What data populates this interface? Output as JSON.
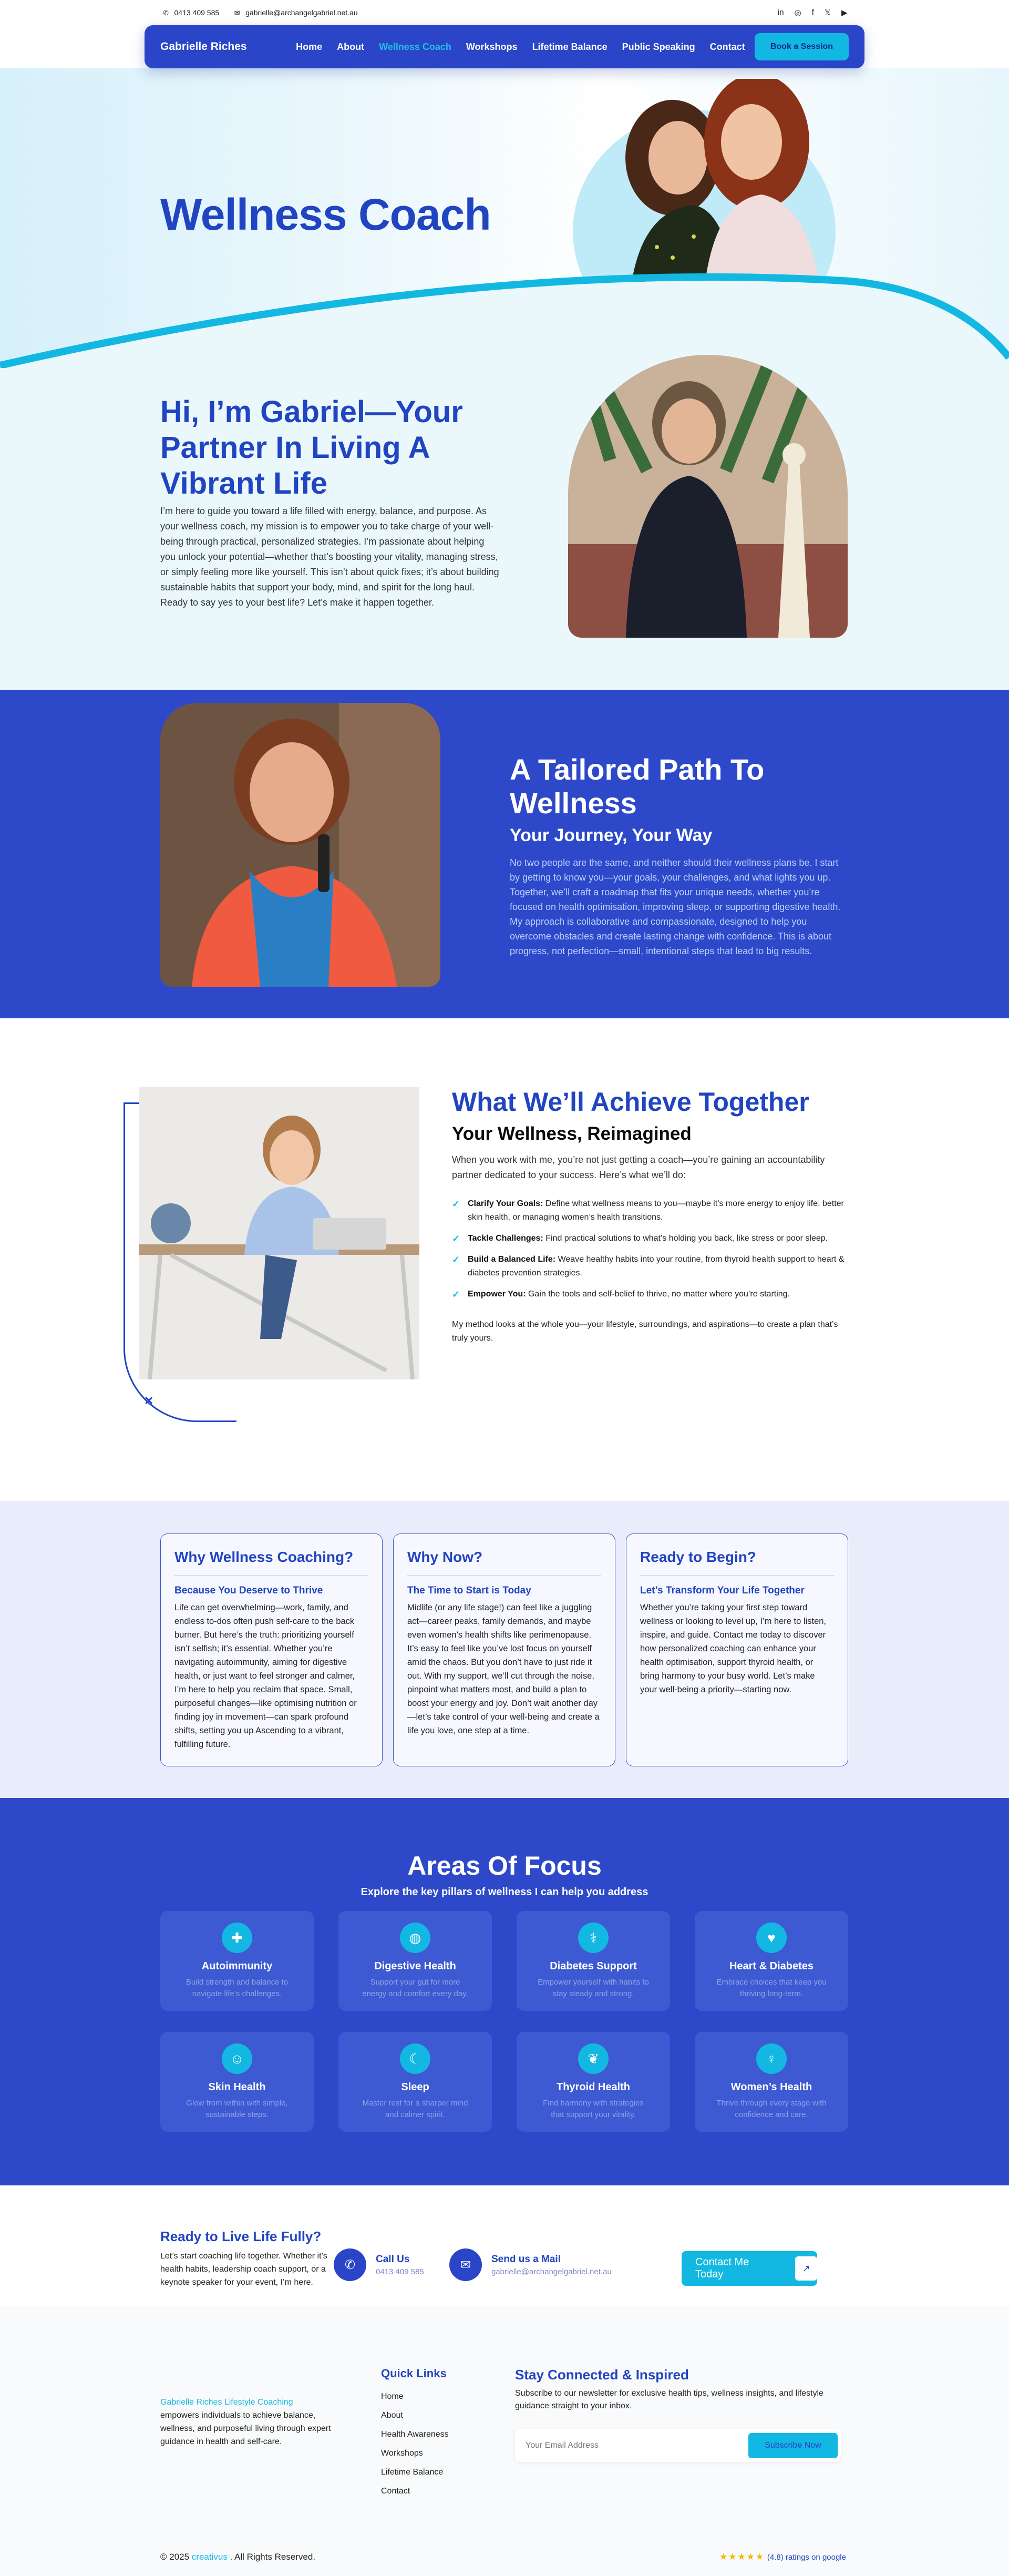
{
  "topbar": {
    "phone": "0413 409 585",
    "email": "gabrielle@archangelgabriel.net.au",
    "social": [
      {
        "icon": "linkedin-icon",
        "glyph": "in"
      },
      {
        "icon": "instagram-icon",
        "glyph": "◎"
      },
      {
        "icon": "facebook-icon",
        "glyph": "f"
      },
      {
        "icon": "x-icon",
        "glyph": "𝕏"
      },
      {
        "icon": "youtube-icon",
        "glyph": "▶"
      }
    ]
  },
  "nav": {
    "brand": "Gabrielle Riches",
    "items": [
      "Home",
      "About",
      "Wellness Coach",
      "Workshops",
      "Lifetime Balance",
      "Public Speaking",
      "Contact"
    ],
    "active_index": 2,
    "cta": "Book a Session"
  },
  "hero": {
    "title": "Wellness Coach"
  },
  "intro": {
    "heading": "Hi, I’m Gabriel—Your Partner In Living A Vibrant Life",
    "body": "I’m here to guide you toward a life filled with energy, balance, and purpose. As your wellness coach, my mission is to empower you to take charge of your well-being through practical, personalized strategies. I’m passionate about helping you unlock your potential—whether that’s boosting your vitality, managing stress, or simply feeling more like yourself. This isn’t about quick fixes; it’s about building sustainable habits that support your body, mind, and spirit for the long haul. Ready to say yes to your best life? Let’s make it happen together."
  },
  "tailored": {
    "heading": "A Tailored Path To Wellness",
    "subheading": "Your Journey, Your Way",
    "body": "No two people are the same, and neither should their wellness plans be. I start by getting to know you—your goals, your challenges, and what lights you up. Together, we’ll craft a roadmap that fits your unique needs, whether you’re focused on health optimisation, improving sleep, or supporting digestive health. My approach is collaborative and compassionate, designed to help you overcome obstacles and create lasting change with confidence. This is about progress, not perfection—small, intentional steps that lead to big results."
  },
  "achieve": {
    "heading": "What We’ll Achieve Together",
    "subheading": "Your Wellness, Reimagined",
    "lead": "When you work with me, you’re not just getting a coach—you’re gaining an accountability partner dedicated to your success. Here’s what we’ll do:",
    "items": [
      {
        "title": "Clarify Your Goals:",
        "text": " Define what wellness means to you—maybe it’s more energy to enjoy life, better skin health, or managing women’s health transitions."
      },
      {
        "title": "Tackle Challenges:",
        "text": " Find practical solutions to what’s holding you back, like stress or poor sleep."
      },
      {
        "title": "Build a Balanced Life:",
        "text": " Weave healthy habits into your routine, from thyroid health support to heart & diabetes prevention strategies."
      },
      {
        "title": "Empower You:",
        "text": " Gain the tools and self-belief to thrive, no matter where you’re starting."
      }
    ],
    "closing": "My method looks at the whole you—your lifestyle, surroundings, and aspirations—to create a plan that’s truly yours."
  },
  "why": [
    {
      "title": "Why Wellness Coaching?",
      "subtitle": "Because You Deserve to Thrive",
      "body": "Life can get overwhelming—work, family, and endless to-dos often push self-care to the back burner. But here’s the truth: prioritizing yourself isn’t selfish; it’s essential. Whether you’re navigating autoimmunity, aiming for digestive health, or just want to feel stronger and calmer, I’m here to help you reclaim that space. Small, purposeful changes—like optimising nutrition or finding joy in movement—can spark profound shifts, setting you up Ascending to a vibrant, fulfilling future."
    },
    {
      "title": "Why Now?",
      "subtitle": "The Time to Start is Today",
      "body": "Midlife (or any life stage!) can feel like a juggling act—career peaks, family demands, and maybe even women’s health shifts like perimenopause. It’s easy to feel like you’ve lost focus on yourself amid the chaos. But you don’t have to just ride it out. With my support, we’ll cut through the noise, pinpoint what matters most, and build a plan to boost your energy and joy. Don’t wait another day—let’s take control of your well-being and create a life you love, one step at a time."
    },
    {
      "title": "Ready to Begin?",
      "subtitle": "Let’s Transform Your Life Together",
      "body": "Whether you’re taking your first step toward wellness or looking to level up, I’m here to listen, inspire, and guide. Contact me today to discover how personalized coaching can enhance your health optimisation, support thyroid health, or bring harmony to your busy world. Let’s make your well-being a priority—starting now."
    }
  ],
  "areas": {
    "heading": "Areas Of Focus",
    "subheading": "Explore the key pillars of wellness I can help you address",
    "tiles": [
      {
        "icon": "shield-icon",
        "glyph": "✚",
        "title": "Autoimmunity",
        "text": "Build strength and balance to navigate life’s challenges."
      },
      {
        "icon": "stomach-icon",
        "glyph": "◍",
        "title": "Digestive Health",
        "text": "Support your gut for more energy and comfort every day."
      },
      {
        "icon": "glucose-icon",
        "glyph": "⚕",
        "title": "Diabetes Support",
        "text": "Empower yourself with habits to stay steady and strong."
      },
      {
        "icon": "heart-icon",
        "glyph": "♥",
        "title": "Heart & Diabetes",
        "text": "Embrace choices that keep you thriving long-term."
      },
      {
        "icon": "skin-icon",
        "glyph": "☺",
        "title": "Skin Health",
        "text": "Glow from within with simple, sustainable steps."
      },
      {
        "icon": "moon-icon",
        "glyph": "☾",
        "title": "Sleep",
        "text": "Master rest for a sharper mind and calmer spirit."
      },
      {
        "icon": "thyroid-icon",
        "glyph": "❦",
        "title": "Thyroid Health",
        "text": "Find harmony with strategies that support your vitality."
      },
      {
        "icon": "female-icon",
        "glyph": "♀",
        "title": "Women’s Health",
        "text": "Thrive through every stage with confidence and care."
      }
    ]
  },
  "strip": {
    "heading": "Ready to Live Life Fully?",
    "body": "Let’s start coaching life together. Whether it’s health habits, leadership coach support, or a keynote speaker for your event, I’m here.",
    "call_label": "Call Us",
    "call_value": "0413 409 585",
    "mail_label": "Send us a Mail",
    "mail_value": "gabrielle@archangelgabriel.net.au",
    "button": "Contact Me Today"
  },
  "footer": {
    "brand_name": "Gabrielle Riches Lifestyle Coaching",
    "brand_text": " empowers individuals to achieve balance, wellness, and purposeful living through expert guidance in health and self-care.",
    "quick_links_title": "Quick Links",
    "quick_links": [
      "Home",
      "About",
      "Health Awareness",
      "Workshops",
      "Lifetime Balance",
      "Contact"
    ],
    "newsletter_title": "Stay Connected & Inspired",
    "newsletter_text": "Subscribe to our newsletter for exclusive health tips, wellness insights, and lifestyle guidance straight to your inbox.",
    "email_placeholder": "Your Email Address",
    "subscribe": "Subscribe Now",
    "copyright_prefix": "© 2025 ",
    "copyright_brand": "creativus",
    "copyright_suffix": " . All Rights Reserved.",
    "stars": "★★★★★",
    "rating": "(4.8) ratings on google"
  },
  "colors": {
    "primary": "#2d49c9",
    "accent": "#13b8e2",
    "heading": "#2144c1"
  }
}
